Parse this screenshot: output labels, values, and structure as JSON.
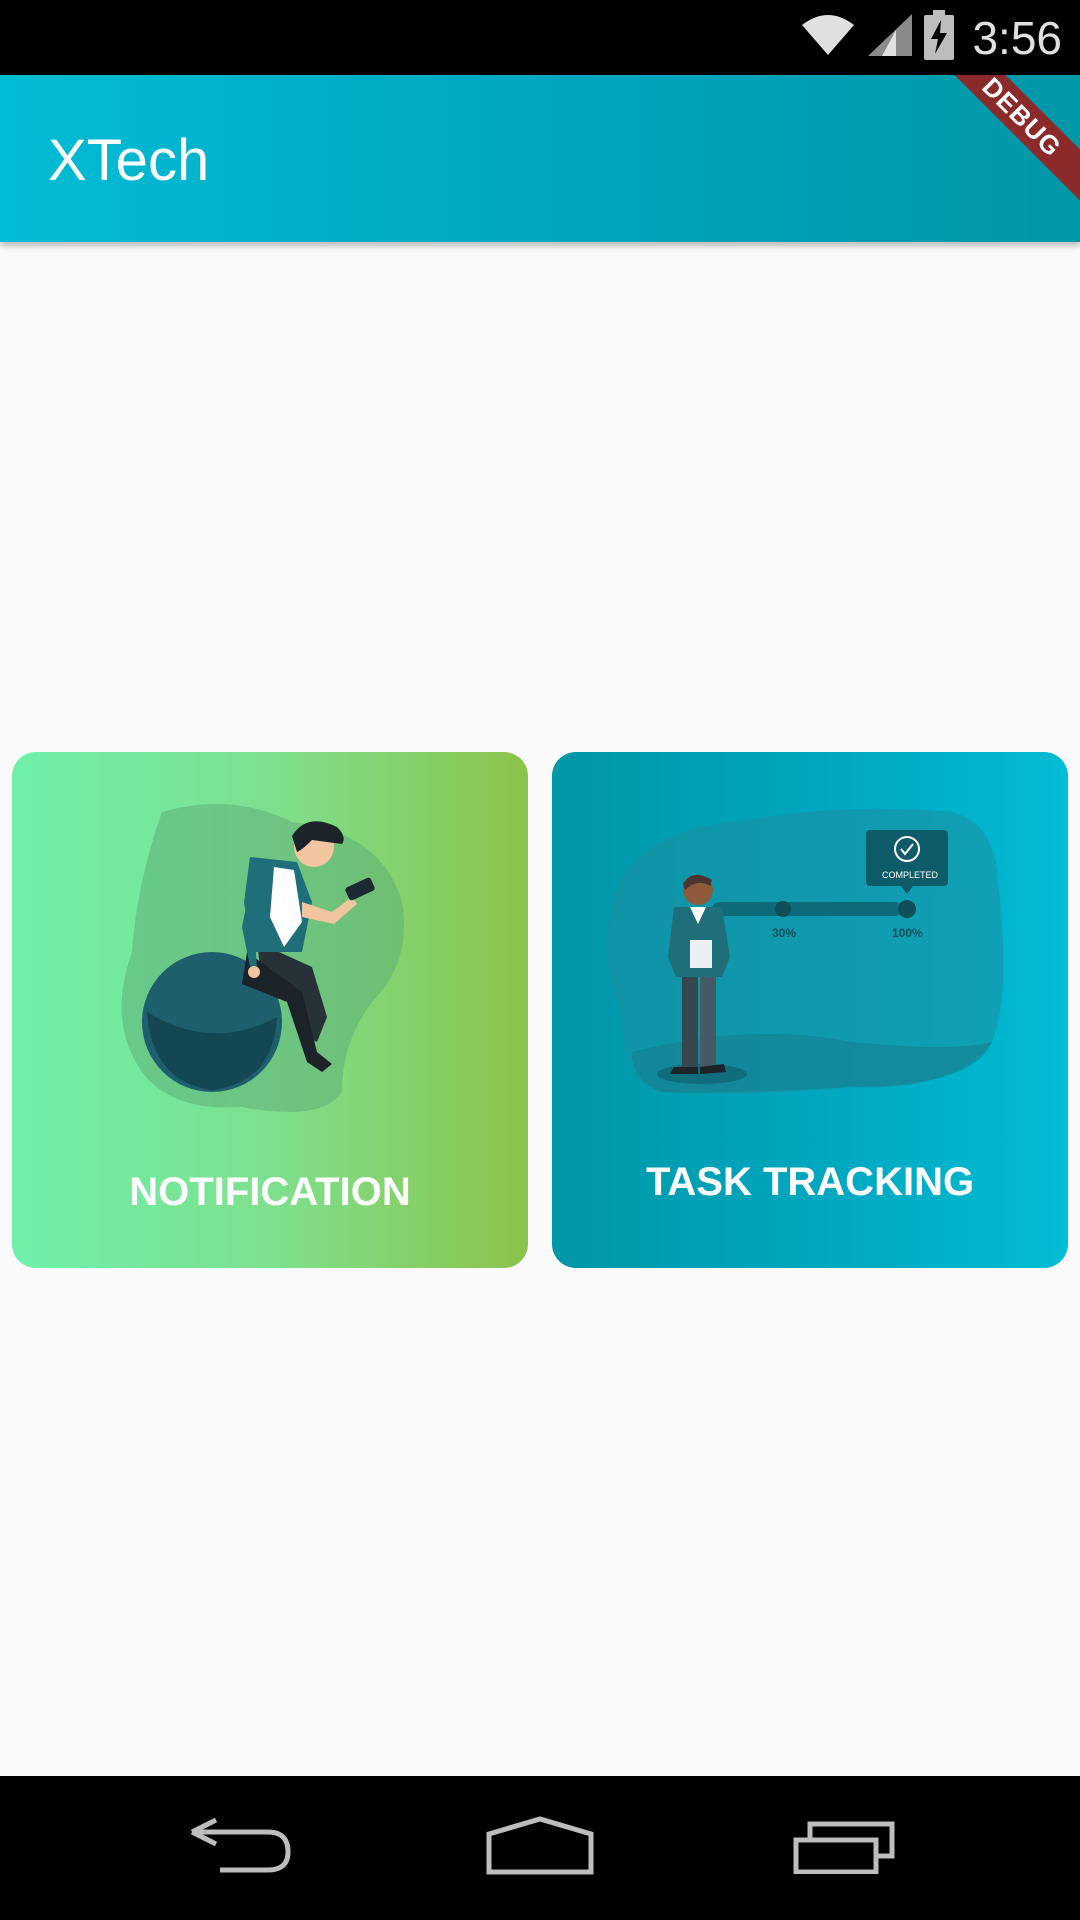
{
  "status_bar": {
    "time": "3:56",
    "icons": [
      "wifi-icon",
      "cell-signal-icon",
      "battery-charging-icon"
    ]
  },
  "app_bar": {
    "title": "XTech",
    "debug_banner": "DEBUG"
  },
  "cards": [
    {
      "label": "NOTIFICATION",
      "illustration": "person-on-ball-with-phone",
      "colors": [
        "#6ef0ab",
        "#8bc34a"
      ]
    },
    {
      "label": "TASK TRACKING",
      "illustration": "person-with-progress-tracker",
      "progress_labels": [
        "30%",
        "100%"
      ],
      "badge": "COMPLETED",
      "colors": [
        "#0097a7",
        "#00bcd4"
      ]
    }
  ],
  "nav_bar": {
    "icons": [
      "back-icon",
      "home-icon",
      "recents-icon"
    ]
  }
}
